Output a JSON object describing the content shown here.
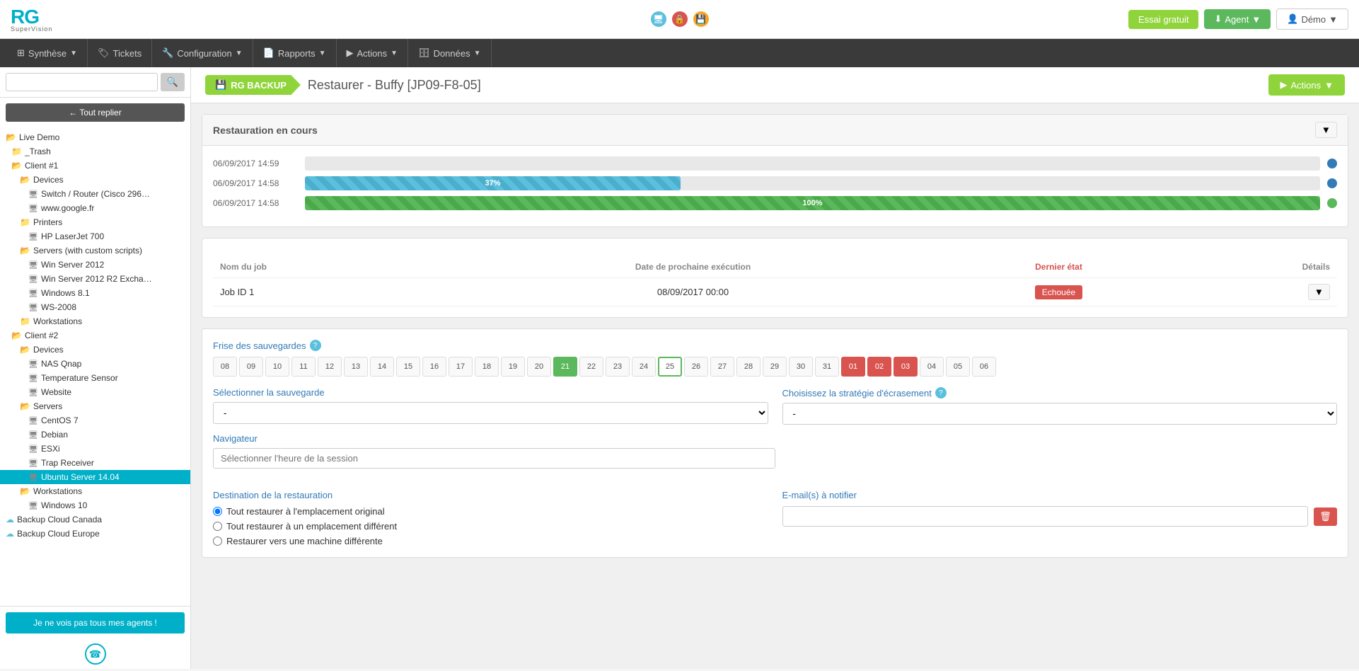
{
  "topnav": {
    "logo_text": "RG",
    "logo_sub": "SuperVision",
    "icons": [
      {
        "name": "monitor-icon",
        "symbol": "🖥"
      },
      {
        "name": "lock-icon",
        "symbol": "🔒"
      },
      {
        "name": "db-icon",
        "symbol": "💾"
      }
    ],
    "trial_label": "Essai gratuit",
    "agent_label": "Agent",
    "demo_label": "Démo"
  },
  "navbar": {
    "items": [
      {
        "label": "Synthèse",
        "icon": "grid"
      },
      {
        "label": "Tickets",
        "icon": "tag"
      },
      {
        "label": "Configuration",
        "icon": "wrench"
      },
      {
        "label": "Rapports",
        "icon": "file"
      },
      {
        "label": "Actions",
        "icon": "play"
      },
      {
        "label": "Données",
        "icon": "database"
      }
    ]
  },
  "sidebar": {
    "search_placeholder": "",
    "reply_all": "← Tout replier",
    "tree": [
      {
        "label": "Live Demo",
        "indent": 0,
        "type": "folder-blue",
        "expanded": true
      },
      {
        "label": "_Trash",
        "indent": 1,
        "type": "folder-gray"
      },
      {
        "label": "Client #1",
        "indent": 1,
        "type": "folder-teal",
        "expanded": true
      },
      {
        "label": "Devices",
        "indent": 2,
        "type": "folder-orange",
        "expanded": true
      },
      {
        "label": "Switch / Router (Cisco 296…",
        "indent": 3,
        "type": "server"
      },
      {
        "label": "www.google.fr",
        "indent": 3,
        "type": "server"
      },
      {
        "label": "Printers",
        "indent": 2,
        "type": "folder-red",
        "expanded": true
      },
      {
        "label": "HP LaserJet 700",
        "indent": 3,
        "type": "server"
      },
      {
        "label": "Servers (with custom scripts)",
        "indent": 2,
        "type": "folder-teal",
        "expanded": true
      },
      {
        "label": "Win Server 2012",
        "indent": 3,
        "type": "server"
      },
      {
        "label": "Win Server 2012 R2 Excha…",
        "indent": 3,
        "type": "server"
      },
      {
        "label": "Windows 8.1",
        "indent": 3,
        "type": "server"
      },
      {
        "label": "WS-2008",
        "indent": 3,
        "type": "server"
      },
      {
        "label": "Workstations",
        "indent": 2,
        "type": "folder-orange"
      },
      {
        "label": "Client #2",
        "indent": 1,
        "type": "folder-teal",
        "expanded": true
      },
      {
        "label": "Devices",
        "indent": 2,
        "type": "folder-orange",
        "expanded": true
      },
      {
        "label": "NAS Qnap",
        "indent": 3,
        "type": "server"
      },
      {
        "label": "Temperature Sensor",
        "indent": 3,
        "type": "server"
      },
      {
        "label": "Website",
        "indent": 3,
        "type": "server"
      },
      {
        "label": "Servers",
        "indent": 2,
        "type": "folder-orange",
        "expanded": true
      },
      {
        "label": "CentOS 7",
        "indent": 3,
        "type": "server"
      },
      {
        "label": "Debian",
        "indent": 3,
        "type": "server"
      },
      {
        "label": "ESXi",
        "indent": 3,
        "type": "server"
      },
      {
        "label": "Trap Receiver",
        "indent": 3,
        "type": "server"
      },
      {
        "label": "Ubuntu Server 14.04",
        "indent": 3,
        "type": "server",
        "active": true
      },
      {
        "label": "Workstations",
        "indent": 2,
        "type": "folder-orange",
        "expanded": true
      },
      {
        "label": "Windows 10",
        "indent": 3,
        "type": "server"
      },
      {
        "label": "Backup Cloud Canada",
        "indent": 0,
        "type": "cloud"
      },
      {
        "label": "Backup Cloud Europe",
        "indent": 0,
        "type": "cloud"
      }
    ],
    "agents_btn": "Je ne vois pas tous mes agents !"
  },
  "page": {
    "badge": "RG BACKUP",
    "title": "Restaurer - Buffy [JP09-F8-05]",
    "actions_label": "Actions"
  },
  "restoration": {
    "panel_title": "Restauration en cours",
    "rows": [
      {
        "date": "06/09/2017 14:59",
        "progress": 0,
        "type": "empty"
      },
      {
        "date": "06/09/2017 14:58",
        "progress": 37,
        "type": "blue",
        "label": "37%"
      },
      {
        "date": "06/09/2017 14:58",
        "progress": 100,
        "type": "green",
        "label": "100%"
      }
    ]
  },
  "job": {
    "col_name": "Nom du job",
    "col_date": "Date de prochaine exécution",
    "col_status": "Dernier état",
    "col_details": "Détails",
    "rows": [
      {
        "name": "Job ID 1",
        "date": "08/09/2017 00:00",
        "status": "Echouée"
      }
    ]
  },
  "frise": {
    "label": "Frise des sauvegardes",
    "days": [
      {
        "num": "08",
        "state": "normal"
      },
      {
        "num": "09",
        "state": "normal"
      },
      {
        "num": "10",
        "state": "normal"
      },
      {
        "num": "11",
        "state": "normal"
      },
      {
        "num": "12",
        "state": "normal"
      },
      {
        "num": "13",
        "state": "normal"
      },
      {
        "num": "14",
        "state": "normal"
      },
      {
        "num": "15",
        "state": "normal"
      },
      {
        "num": "16",
        "state": "normal"
      },
      {
        "num": "17",
        "state": "normal"
      },
      {
        "num": "18",
        "state": "normal"
      },
      {
        "num": "19",
        "state": "normal"
      },
      {
        "num": "20",
        "state": "normal"
      },
      {
        "num": "21",
        "state": "green"
      },
      {
        "num": "22",
        "state": "normal"
      },
      {
        "num": "23",
        "state": "normal"
      },
      {
        "num": "24",
        "state": "normal"
      },
      {
        "num": "25",
        "state": "active-border"
      },
      {
        "num": "26",
        "state": "normal"
      },
      {
        "num": "27",
        "state": "normal"
      },
      {
        "num": "28",
        "state": "normal"
      },
      {
        "num": "29",
        "state": "normal"
      },
      {
        "num": "30",
        "state": "normal"
      },
      {
        "num": "31",
        "state": "normal"
      },
      {
        "num": "01",
        "state": "red"
      },
      {
        "num": "02",
        "state": "red"
      },
      {
        "num": "03",
        "state": "red"
      },
      {
        "num": "04",
        "state": "normal"
      },
      {
        "num": "05",
        "state": "normal"
      },
      {
        "num": "06",
        "state": "normal"
      }
    ]
  },
  "form": {
    "select_save_label": "Sélectionner la sauvegarde",
    "select_save_default": "-",
    "select_strategy_label": "Choisissez la stratégie d'écrasement",
    "select_strategy_default": "-",
    "nav_label": "Navigateur",
    "nav_placeholder": "Sélectionner l'heure de la session",
    "dest_label": "Destination de la restauration",
    "dest_options": [
      "Tout restaurer à l'emplacement original",
      "Tout restaurer à un emplacement différent",
      "Restaurer vers une machine différente"
    ],
    "email_label": "E-mail(s) à notifier",
    "email_value": ""
  }
}
